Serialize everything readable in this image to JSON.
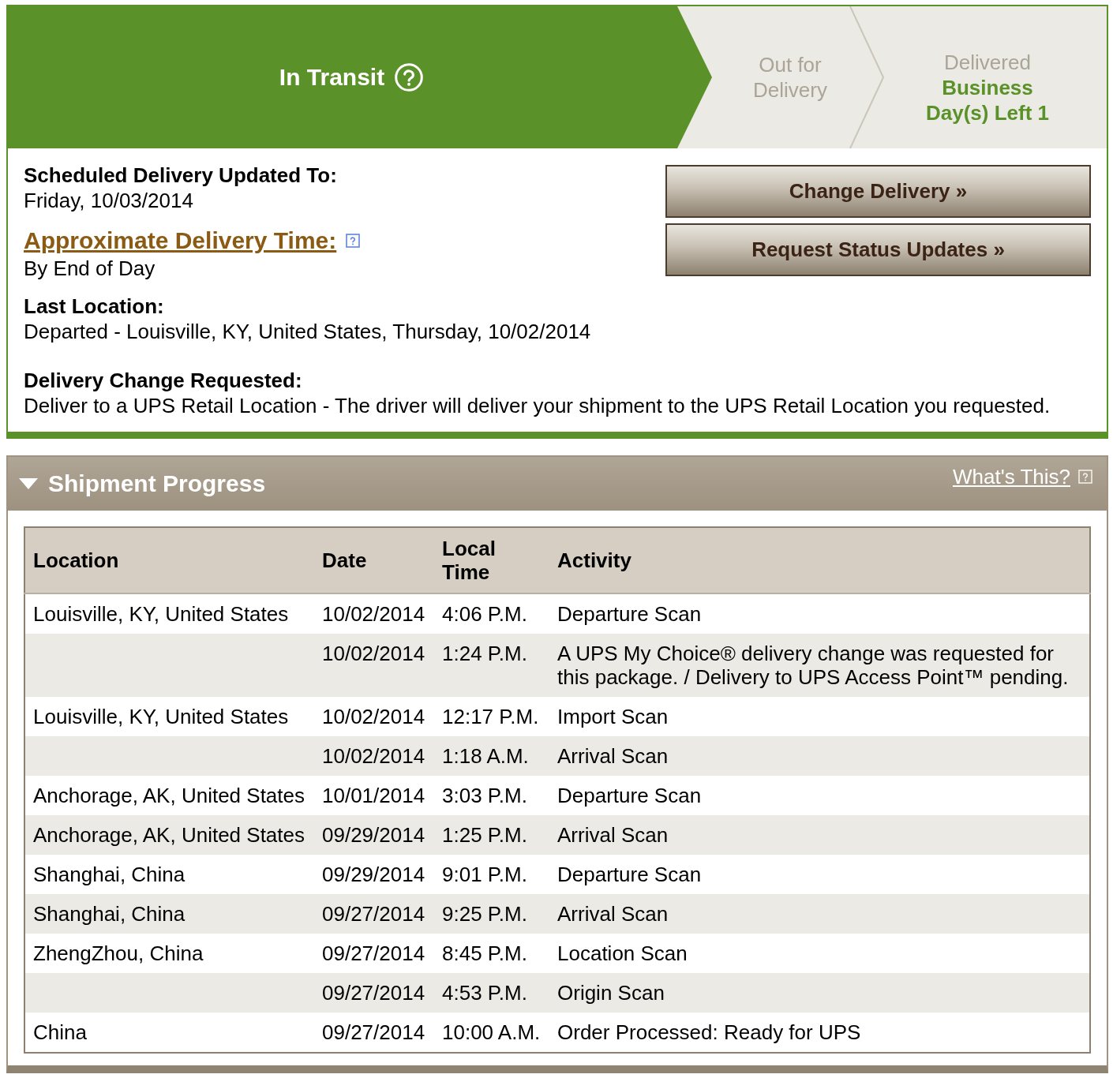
{
  "progress_steps": [
    {
      "label": "In Transit",
      "selected": true
    },
    {
      "label": "Out for Delivery",
      "selected": false
    },
    {
      "label": "Delivered",
      "selected": false,
      "note": "Business Day(s) Left 1"
    }
  ],
  "delivery_details": {
    "scheduled_delivery": {
      "label": "Scheduled Delivery Updated To:",
      "value": "Friday, 10/03/2014"
    },
    "approximate_delivery_time": {
      "link": "Approximate Delivery Time:",
      "value": "By End of Day"
    },
    "last_location": {
      "label": "Last Location:",
      "value": "Departed - Louisville, KY, United States, Thursday, 10/02/2014"
    },
    "delivery_change_requested": {
      "label": "Delivery Change Requested:",
      "value": "Deliver to a UPS Retail Location - The driver will deliver your shipment to the UPS Retail Location you requested."
    }
  },
  "actions": [
    {
      "label": "Change Delivery »"
    },
    {
      "label": "Request Status Updates »"
    }
  ],
  "shipment_progress": {
    "title": "Shipment Progress",
    "expanded": true,
    "help_link": "What's This?",
    "table": {
      "columns": [
        "Location",
        "Date",
        "Local Time",
        "Activity"
      ],
      "rows": [
        {
          "location": "Louisville, KY, United States",
          "date": "10/02/2014",
          "local_time": "4:06 P.M.",
          "activity": "Departure Scan"
        },
        {
          "date": "10/02/2014",
          "local_time": "1:24 P.M.",
          "activity": "A UPS My Choice® delivery change was requested for this package. / Delivery to UPS Access Point™ pending."
        },
        {
          "location": "Louisville, KY, United States",
          "date": "10/02/2014",
          "local_time": "12:17 P.M.",
          "activity": "Import Scan"
        },
        {
          "date": "10/02/2014",
          "local_time": "1:18 A.M.",
          "activity": "Arrival Scan"
        },
        {
          "location": "Anchorage, AK, United States",
          "date": "10/01/2014",
          "local_time": "3:03 P.M.",
          "activity": "Departure Scan"
        },
        {
          "location": "Anchorage, AK, United States",
          "date": "09/29/2014",
          "local_time": "1:25 P.M.",
          "activity": "Arrival Scan"
        },
        {
          "location": "Shanghai, China",
          "date": "09/29/2014",
          "local_time": "9:01 P.M.",
          "activity": "Departure Scan"
        },
        {
          "location": "Shanghai, China",
          "date": "09/27/2014",
          "local_time": "9:25 P.M.",
          "activity": "Arrival Scan"
        },
        {
          "location": "ZhengZhou, China",
          "date": "09/27/2014",
          "local_time": "8:45 P.M.",
          "activity": "Location Scan"
        },
        {
          "date": "09/27/2014",
          "local_time": "4:53 P.M.",
          "activity": "Origin Scan"
        },
        {
          "location": "China",
          "date": "09/27/2014",
          "local_time": "10:00 A.M.",
          "activity": "Order Processed: Ready for UPS"
        }
      ]
    }
  }
}
